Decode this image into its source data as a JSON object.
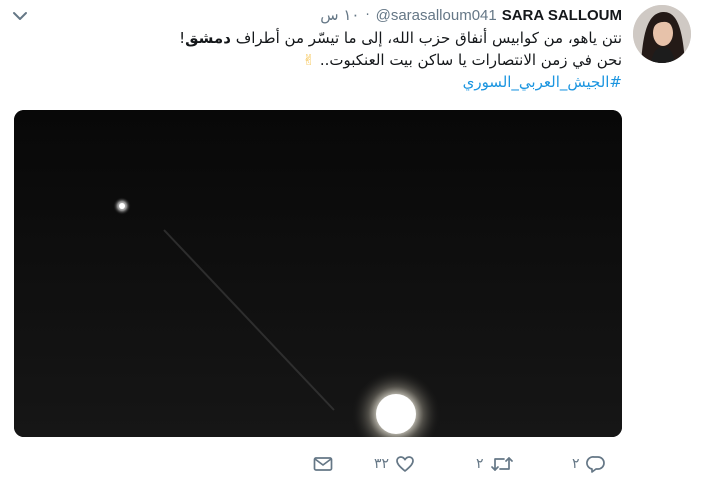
{
  "tweet": {
    "author": {
      "display_name": "SARA SALLOUM",
      "handle": "@sarasalloum041"
    },
    "time": "١٠ س",
    "separator": "·",
    "text": {
      "line1_prefix": "نتن ياهو، من كوابيس أنفاق حزب الله، إلى ما تيسّر من أطراف ",
      "line1_bold": "دمشق",
      "line1_suffix": "!",
      "line2": "نحن في زمن الانتصارات يا ساكن بيت العنكبوت..",
      "line2_emoji": "✌",
      "hashtag": "#الجيش_العربي_السوري"
    },
    "actions": {
      "reply_count": "٢",
      "retweet_count": "٢",
      "like_count": "٣٢"
    }
  },
  "colors": {
    "text_primary": "#14171a",
    "text_secondary": "#657786",
    "link": "#1b95e0",
    "media_background": "#0b0b0b"
  },
  "icons": {
    "menu": "chevron-down-icon",
    "reply": "reply-icon",
    "retweet": "retweet-icon",
    "like": "heart-icon",
    "dm": "envelope-icon"
  }
}
